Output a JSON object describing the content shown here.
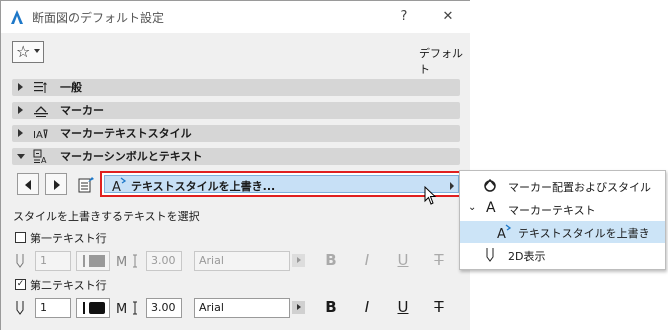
{
  "window": {
    "title": "断面図のデフォルト設定",
    "help_glyph": "?",
    "close_glyph": "✕"
  },
  "header": {
    "favorites_icon": "star-icon",
    "default_label": "デフォルト"
  },
  "panels": [
    {
      "label": "一般",
      "expanded": false,
      "icon": "general-settings-icon"
    },
    {
      "label": "マーカー",
      "expanded": false,
      "icon": "marker-icon"
    },
    {
      "label": "マーカーテキストスタイル",
      "expanded": false,
      "icon": "marker-text-style-icon"
    },
    {
      "label": "マーカーシンボルとテキスト",
      "expanded": true,
      "icon": "marker-symbol-text-icon"
    }
  ],
  "page_selector": {
    "label": "テキストスタイルを上書き..."
  },
  "override": {
    "section_label": "スタイルを上書きするテキストを選択",
    "rows": [
      {
        "label": "第一テキスト行",
        "checked": false,
        "pen": "1",
        "size": "3.00",
        "font": "Arial",
        "enabled": false
      },
      {
        "label": "第二テキスト行",
        "checked": true,
        "pen": "1",
        "size": "3.00",
        "font": "Arial",
        "enabled": true
      }
    ],
    "format_glyphs": {
      "bold": "B",
      "italic": "I",
      "underline": "U",
      "strike": "T"
    }
  },
  "popup_menu": {
    "items": [
      {
        "label": "マーカー配置およびスタイル",
        "icon": "marker-placement-icon",
        "selected": false,
        "indent": 0
      },
      {
        "label": "マーカーテキスト",
        "icon": "text-icon",
        "selected": false,
        "indent": 0,
        "expanded": true
      },
      {
        "label": "テキストスタイルを上書き",
        "icon": "text-style-override-icon",
        "selected": true,
        "indent": 1
      },
      {
        "label": "2D表示",
        "icon": "pen-icon",
        "selected": false,
        "indent": 0
      }
    ]
  },
  "colors": {
    "highlight_border": "#e02020",
    "selection_fill": "#c7e0f6",
    "menu_selection": "#cce4f7",
    "accent_blue": "#1e78c8"
  }
}
